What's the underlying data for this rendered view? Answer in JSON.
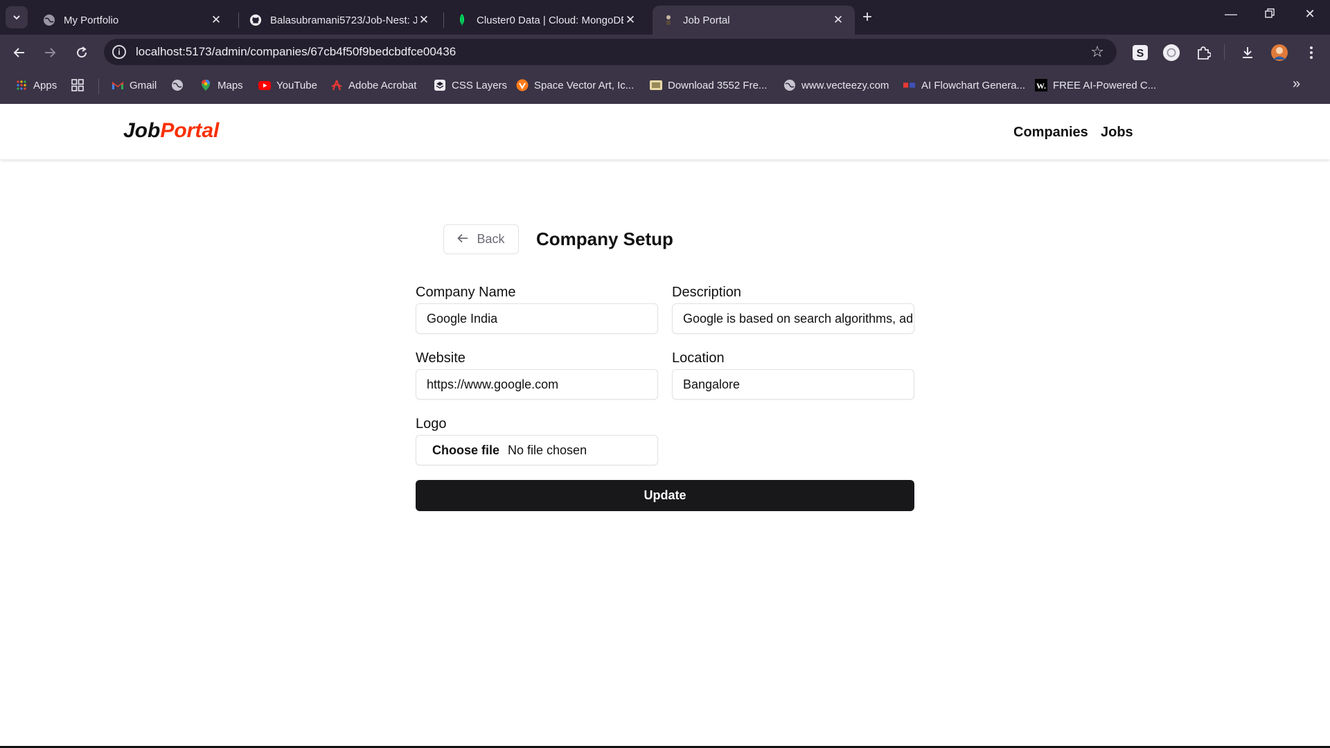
{
  "browser": {
    "tabs": [
      {
        "title": "My Portfolio",
        "active": false
      },
      {
        "title": "Balasubramani5723/Job-Nest: J",
        "active": false
      },
      {
        "title": "Cluster0 Data | Cloud: MongoDB",
        "active": false
      },
      {
        "title": "Job Portal",
        "active": true
      }
    ],
    "url": "localhost:5173/admin/companies/67cb4f50f9bedcbdfce00436",
    "bookmarks": [
      {
        "label": "Apps",
        "icon": "apps-grid-icon"
      },
      {
        "label": "",
        "icon": "tab-groups-icon"
      },
      {
        "label": "Gmail",
        "icon": "gmail-icon"
      },
      {
        "label": "",
        "icon": "globe-icon"
      },
      {
        "label": "Maps",
        "icon": "maps-pin-icon"
      },
      {
        "label": "YouTube",
        "icon": "youtube-icon"
      },
      {
        "label": "Adobe Acrobat",
        "icon": "acrobat-icon"
      },
      {
        "label": "CSS Layers",
        "icon": "css-layers-icon"
      },
      {
        "label": "Space Vector Art, Ic...",
        "icon": "vector-art-icon"
      },
      {
        "label": "Download 3552 Fre...",
        "icon": "download-image-icon"
      },
      {
        "label": "www.vecteezy.com",
        "icon": "globe-icon"
      },
      {
        "label": "AI Flowchart Genera...",
        "icon": "flowchart-icon"
      },
      {
        "label": "FREE AI-Powered C...",
        "icon": "w-icon"
      }
    ],
    "more_bookmarks": "»",
    "colors": {
      "tabbar": "#231f2e",
      "toolbar": "#3a3446"
    }
  },
  "app": {
    "logo_part1": "Job",
    "logo_part2": "Portal",
    "nav": [
      "Companies",
      "Jobs"
    ],
    "colors": {
      "brand_red": "#f83002",
      "button_dark": "#18181b"
    }
  },
  "form": {
    "back_label": "Back",
    "title": "Company Setup",
    "company_name_label": "Company Name",
    "company_name_value": "Google India",
    "description_label": "Description",
    "description_value": "Google is based on search algorithms, ad",
    "website_label": "Website",
    "website_value": "https://www.google.com",
    "location_label": "Location",
    "location_value": "Bangalore",
    "logo_label": "Logo",
    "logo_choose": "Choose file",
    "logo_status": "No file chosen",
    "submit_label": "Update"
  }
}
